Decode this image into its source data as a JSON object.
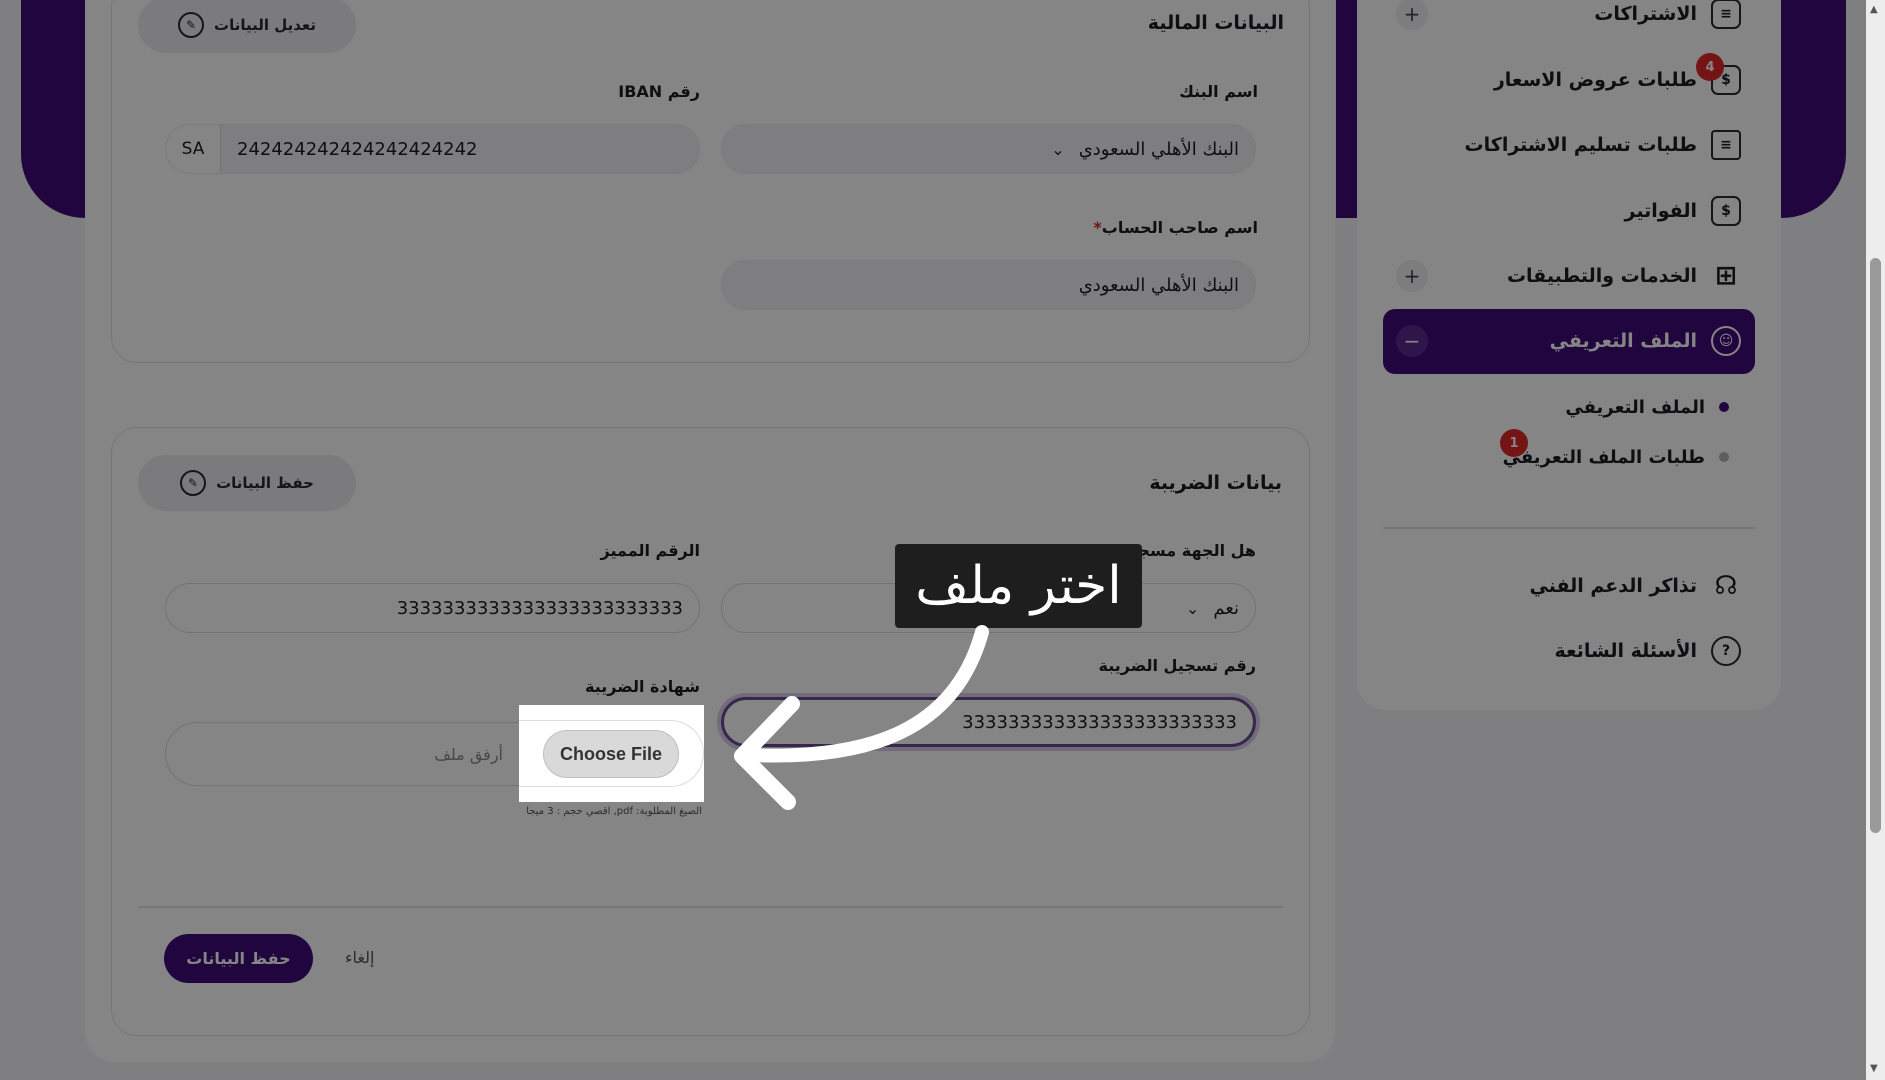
{
  "financial": {
    "title": "البيانات المالية",
    "edit_button": "تعديل البيانات",
    "bank_label": "اسم البنك",
    "bank_value": "البنك الأهلي السعودي",
    "iban_label": "رقم IBAN",
    "iban_prefix": "SA",
    "iban_value": "242424242424242424242",
    "holder_label": "اسم صاحب الحساب",
    "holder_required": "*",
    "holder_value": "البنك الأهلي السعودي"
  },
  "tax": {
    "title": "بيانات الضريبة",
    "save_button_top": "حفظ البيانات",
    "registered_label": "هل الجهة مسجلة في الضريبة؟",
    "registered_value": "نعم",
    "distinct_label": "الرقم المميز",
    "distinct_value": "3333333333333333333333333",
    "reg_number_label": "رقم تسجيل الضريبة",
    "reg_number_value": "333333333333333333333333",
    "certificate_label": "شهادة الضريبة",
    "file_placeholder": "أرفق ملف",
    "file_hint": "الصيغ المطلوبة: pdf, اقصي حجم : 3 ميجا",
    "choose_file": "Choose File",
    "save_button": "حفظ البيانات",
    "cancel_button": "إلغاء"
  },
  "sidebar": {
    "subscriptions": "الاشتراكات",
    "quote_requests": "طلبات عروض الاسعار",
    "quote_badge": "4",
    "delivery_requests": "طلبات تسليم الاشتراكات",
    "invoices": "الفواتير",
    "services": "الخدمات والتطبيقات",
    "profile": "الملف التعريفي",
    "sub_profile": "الملف التعريفي",
    "sub_profile_requests": "طلبات الملف التعريفي",
    "sub_badge": "1",
    "support": "تذاكر الدعم الفني",
    "faq": "الأسئلة الشائعة"
  },
  "tooltip": {
    "text": "اختر ملف"
  },
  "colors": {
    "brand_purple": "#3f0a7a",
    "badge_red": "#e02828"
  }
}
